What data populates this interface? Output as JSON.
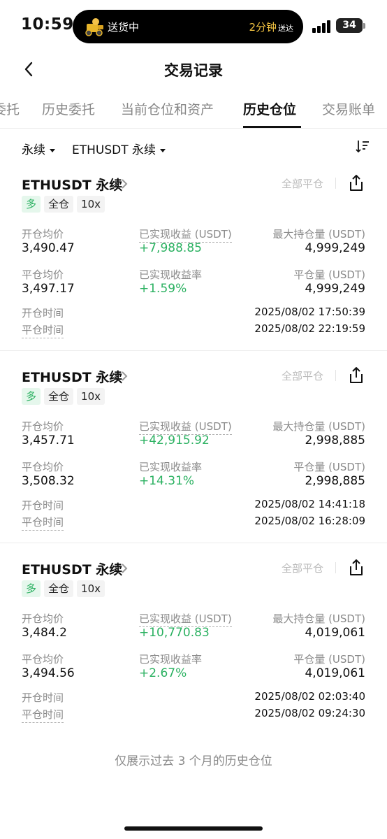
{
  "status_bar": {
    "time": "10:59",
    "activity_label": "送货中",
    "eta_value": "2分钟",
    "eta_suffix": "送达",
    "battery": "34"
  },
  "header": {
    "title": "交易记录"
  },
  "tabs": [
    {
      "label": "委托",
      "active": false
    },
    {
      "label": "历史委托",
      "active": false
    },
    {
      "label": "当前仓位和资产",
      "active": false
    },
    {
      "label": "历史仓位",
      "active": true
    },
    {
      "label": "交易账单",
      "active": false
    }
  ],
  "filters": {
    "type": "永续",
    "symbol": "ETHUSDT 永续"
  },
  "labels": {
    "open_avg": "开仓均价",
    "realized_pnl": "已实现收益 (USDT)",
    "max_position": "最大持仓量 (USDT)",
    "close_avg": "平仓均价",
    "realized_pnl_rate": "已实现收益率",
    "close_amount": "平仓量 (USDT)",
    "open_time": "开仓时间",
    "close_time": "平仓时间",
    "close_all": "全部平仓"
  },
  "positions": [
    {
      "symbol": "ETHUSDT 永续",
      "side": "多",
      "margin_mode": "全仓",
      "leverage": "10x",
      "open_avg": "3,490.47",
      "realized_pnl": "+7,988.85",
      "max_position": "4,999,249",
      "close_avg": "3,497.17",
      "realized_pnl_rate": "+1.59%",
      "close_amount": "4,999,249",
      "open_time": "2025/08/02 17:50:39",
      "close_time": "2025/08/02 22:19:59"
    },
    {
      "symbol": "ETHUSDT 永续",
      "side": "多",
      "margin_mode": "全仓",
      "leverage": "10x",
      "open_avg": "3,457.71",
      "realized_pnl": "+42,915.92",
      "max_position": "2,998,885",
      "close_avg": "3,508.32",
      "realized_pnl_rate": "+14.31%",
      "close_amount": "2,998,885",
      "open_time": "2025/08/02 14:41:18",
      "close_time": "2025/08/02 16:28:09"
    },
    {
      "symbol": "ETHUSDT 永续",
      "side": "多",
      "margin_mode": "全仓",
      "leverage": "10x",
      "open_avg": "3,484.2",
      "realized_pnl": "+10,770.83",
      "max_position": "4,019,061",
      "close_avg": "3,494.56",
      "realized_pnl_rate": "+2.67%",
      "close_amount": "4,019,061",
      "open_time": "2025/08/02 02:03:40",
      "close_time": "2025/08/02 09:24:30"
    }
  ],
  "footer_note": "仅展示过去 3 个月的历史仓位",
  "colors": {
    "profit_green": "#2bb161",
    "long_tag_bg": "#e5f7ec",
    "muted_text": "#8a8a8a",
    "eta_yellow": "#f5c542"
  }
}
